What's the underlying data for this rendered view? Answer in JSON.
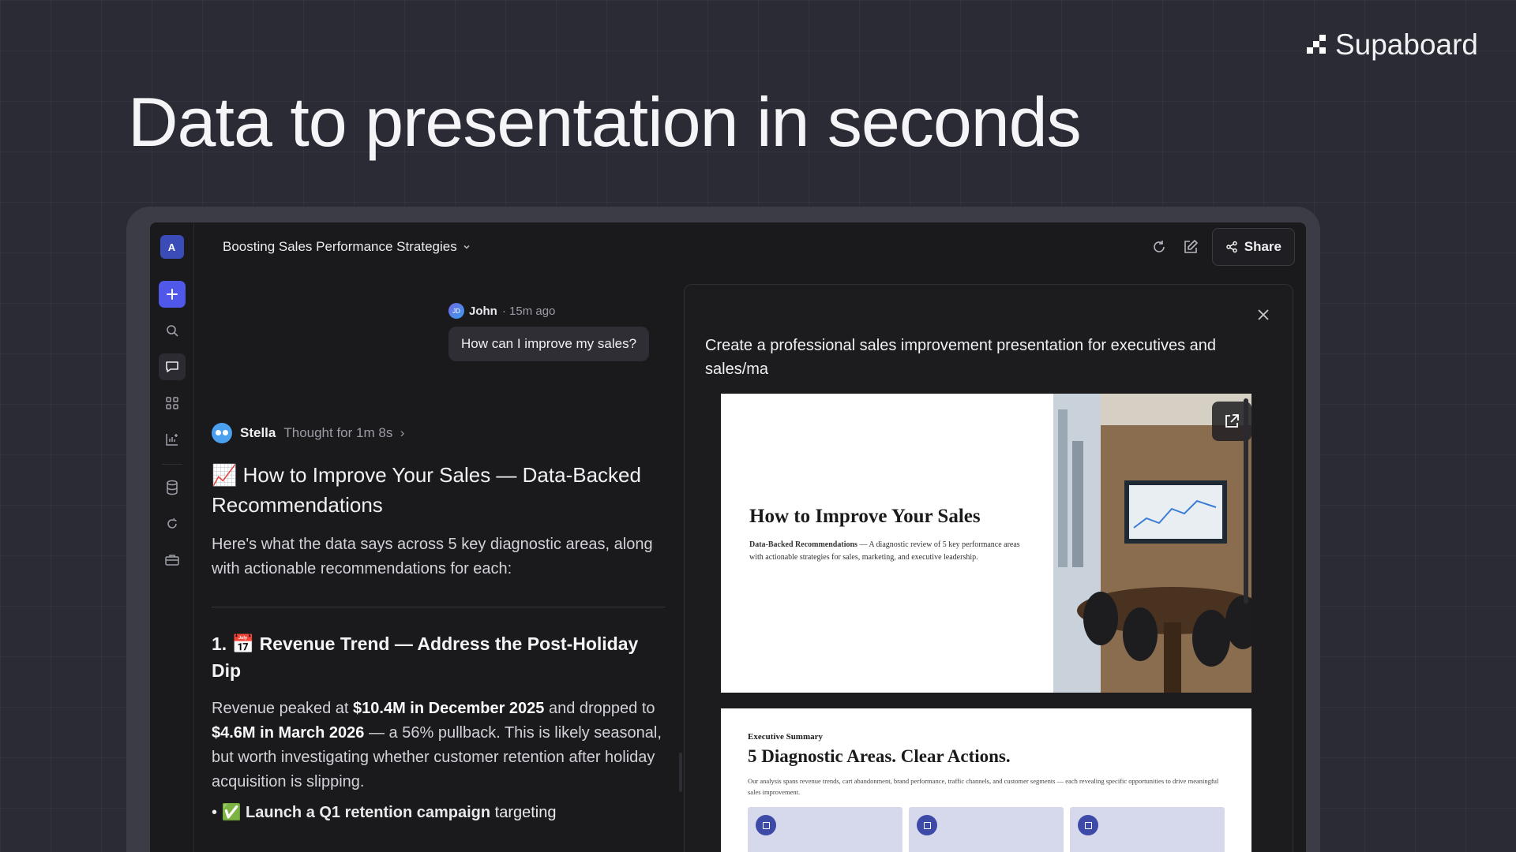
{
  "brand": {
    "name": "Supaboard"
  },
  "hero": {
    "title": "Data to presentation in seconds"
  },
  "sidebar": {
    "workspace_initial": "A"
  },
  "topbar": {
    "conversation_title": "Boosting Sales Performance Strategies",
    "share_label": "Share"
  },
  "chat": {
    "user": {
      "avatar_initials": "JD",
      "name": "John",
      "time": "· 15m ago",
      "message": "How can I improve my sales?"
    },
    "assistant": {
      "name": "Stella",
      "thought": "Thought for 1m 8s",
      "heading": "📈 How to Improve Your Sales — Data-Backed Recommendations",
      "intro": "Here's what the data says across 5 key diagnostic areas, along with actionable recommendations for each:",
      "section1_heading": "1. 📅 Revenue Trend — Address the Post-Holiday Dip",
      "section1_text_a": "Revenue peaked at ",
      "section1_bold_a": "$10.4M in December 2025",
      "section1_text_b": " and dropped to ",
      "section1_bold_b": "$4.6M in March 2026",
      "section1_text_c": " — a 56% pullback. This is likely seasonal, but worth investigating whether customer retention after holiday acquisition is slipping.",
      "bullet1_bold": "✅ Launch a Q1 retention campaign",
      "bullet1_text": " targeting"
    }
  },
  "panel": {
    "prompt": "Create a professional sales improvement presentation for executives and sales/ma",
    "slide1": {
      "title": "How to Improve Your Sales",
      "subtitle_bold": "Data-Backed Recommendations",
      "subtitle_text": " — A diagnostic review of 5 key performance areas with actionable strategies for sales, marketing, and executive leadership."
    },
    "slide2": {
      "eyebrow": "Executive Summary",
      "title": "5 Diagnostic Areas. Clear Actions.",
      "description": "Our analysis spans revenue trends, cart abandonment, brand performance, traffic channels, and customer segments — each revealing specific opportunities to drive meaningful sales improvement."
    }
  }
}
